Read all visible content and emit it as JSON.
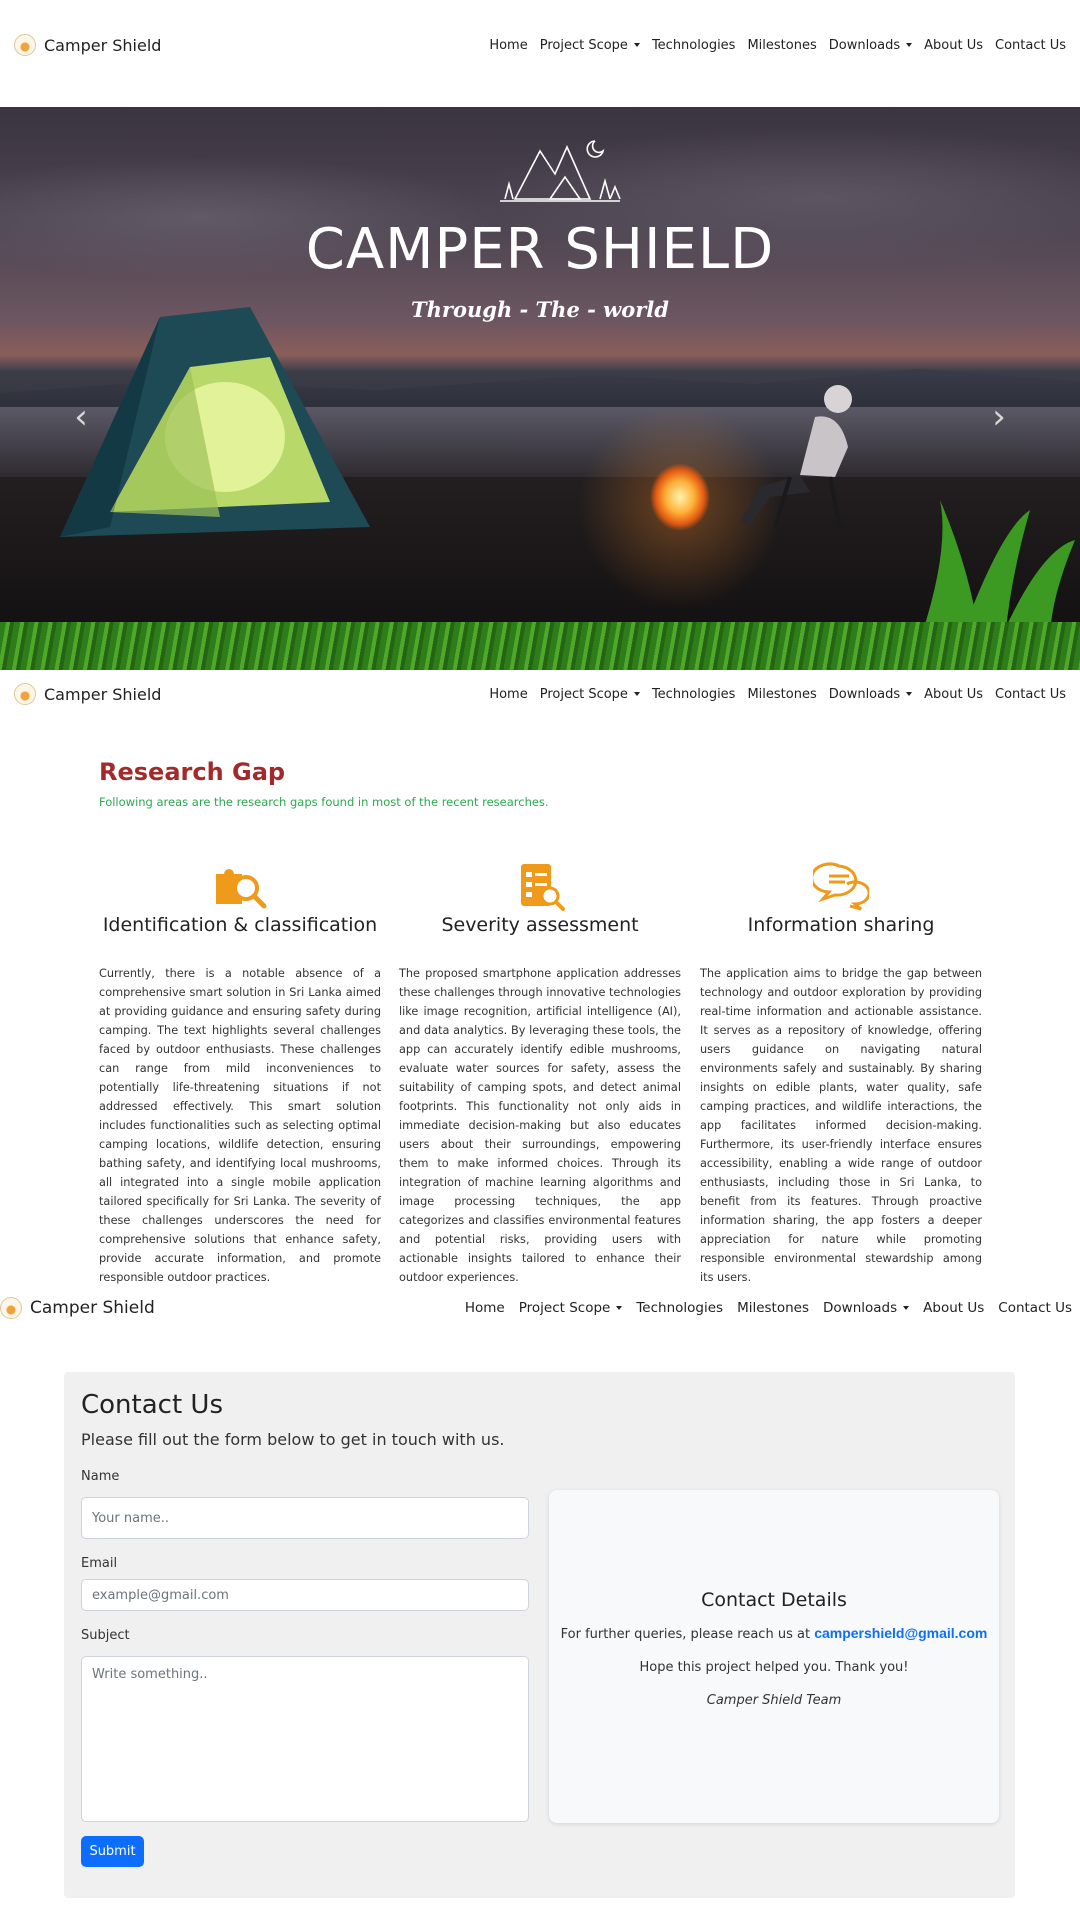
{
  "nav": {
    "brand": "Camper Shield",
    "links": [
      "Home",
      "Project Scope",
      "Technologies",
      "Milestones",
      "Downloads",
      "About Us",
      "Contact Us"
    ]
  },
  "hero": {
    "title": "CAMPER SHIELD",
    "subtitle": "Through - The - world",
    "prev_label": "‹",
    "next_label": "›"
  },
  "research": {
    "title": "Research Gap",
    "subtitle": "Following areas are the research gaps found in most of the recent researches.",
    "columns": [
      {
        "icon": "puzzle-search-icon",
        "heading": "Identification & classification",
        "body": "Currently, there is a notable absence of a comprehensive smart solution in Sri Lanka aimed at providing guidance and ensuring safety during camping. The text highlights several challenges faced by outdoor enthusiasts. These challenges can range from mild inconveniences to potentially life-threatening situations if not addressed effectively. This smart solution includes functionalities such as selecting optimal camping locations, wildlife detection, ensuring bathing safety, and identifying local mushrooms, all integrated into a single mobile application tailored specifically for Sri Lanka. The severity of these challenges underscores the need for comprehensive solutions that enhance safety, provide accurate information, and promote responsible outdoor practices."
      },
      {
        "icon": "checklist-search-icon",
        "heading": "Severity assessment",
        "body": "The proposed smartphone application addresses these challenges through innovative technologies like image recognition, artificial intelligence (AI), and data analytics. By leveraging these tools, the app can accurately identify edible mushrooms, evaluate water sources for safety, assess the suitability of camping spots, and detect animal footprints. This functionality not only aids in immediate decision-making but also educates users about their surroundings, empowering them to make informed choices. Through its integration of machine learning algorithms and image processing techniques, the app categorizes and classifies environmental features and potential risks, providing users with actionable insights tailored to enhance their outdoor experiences."
      },
      {
        "icon": "chat-bubbles-icon",
        "heading": "Information sharing",
        "body": "The application aims to bridge the gap between technology and outdoor exploration by providing real-time information and actionable assistance. It serves as a repository of knowledge, offering users guidance on navigating natural environments safely and sustainably. By sharing insights on edible plants, water quality, safe camping practices, and wildlife interactions, the app facilitates informed decision-making. Furthermore, its user-friendly interface ensures accessibility, enabling a wide range of outdoor enthusiasts, including those in Sri Lanka, to benefit from its features. Through proactive information sharing, the app fosters a deeper appreciation for nature while promoting responsible environmental stewardship among its users."
      }
    ]
  },
  "contact": {
    "title": "Contact Us",
    "subtitle": "Please fill out the form below to get in touch with us.",
    "name_label": "Name",
    "name_placeholder": "Your name..",
    "email_label": "Email",
    "email_placeholder": "example@gmail.com",
    "subject_label": "Subject",
    "subject_placeholder": "Write something..",
    "submit_label": "Submit",
    "details_title": "Contact Details",
    "details_prefix": "For further queries, please reach us at",
    "details_email": "campershield@gmail.com",
    "details_thanks": "Hope this project helped you. Thank you!",
    "details_team": "Camper Shield Team"
  },
  "colors": {
    "accent_red": "#a32a2a",
    "accent_green": "#2ba94f",
    "icon_orange": "#ef9a1a",
    "button_blue": "#0d6efd"
  }
}
